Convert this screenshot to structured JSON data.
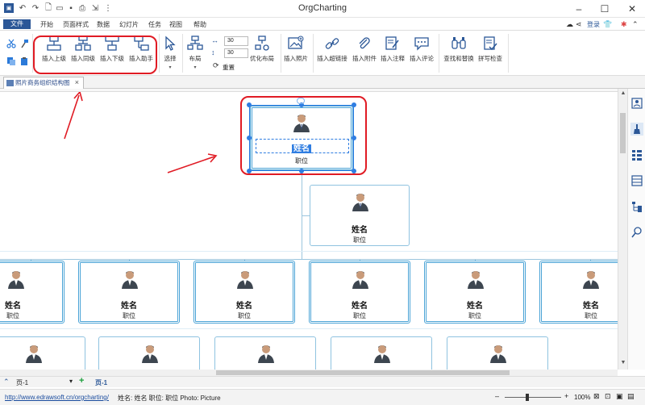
{
  "window": {
    "title": "OrgCharting",
    "login_label": "登录"
  },
  "menu": {
    "file": "文件",
    "items": [
      "开始",
      "页面样式",
      "数据",
      "幻灯片",
      "任务",
      "视图",
      "帮助"
    ]
  },
  "ribbon": {
    "insert_buttons": [
      "插入上级",
      "插入同级",
      "插入下级",
      "插入助手"
    ],
    "select_label": "选择",
    "layout_label": "布局",
    "spin_width": "30",
    "spin_height": "30",
    "reset_label": "重置",
    "optimize_label": "优化布局",
    "insert_photo": "插入照片",
    "insert_link": "插入超链接",
    "insert_attach": "插入附件",
    "insert_note": "插入注释",
    "insert_comment": "插入评论",
    "find_replace": "查找和替换",
    "spell_check": "拼写检查"
  },
  "tab": {
    "label": "照片商务组织结构图",
    "close": "×"
  },
  "chart": {
    "top": {
      "name": "姓名",
      "position": "职位"
    },
    "assistant": {
      "name": "姓名",
      "position": "职位"
    },
    "subordinates": [
      {
        "name": "姓名",
        "position": "职位"
      },
      {
        "name": "姓名",
        "position": "职位"
      },
      {
        "name": "姓名",
        "position": "职位"
      },
      {
        "name": "姓名",
        "position": "职位"
      },
      {
        "name": "姓名",
        "position": "职位"
      },
      {
        "name": "姓名",
        "position": "职位"
      }
    ]
  },
  "pages": {
    "page1": "页-1",
    "active": "页-1",
    "add": "+"
  },
  "status": {
    "url": "http://www.edrawsoft.cn/orgcharting/",
    "info": "姓名: 姓名  职位: 职位  Photo: Picture",
    "zoom": "100%"
  },
  "colors": {
    "accent": "#2b5797",
    "highlight": "#e01b24",
    "card_border": "#4aa3d6",
    "selection": "#2f7de1"
  }
}
